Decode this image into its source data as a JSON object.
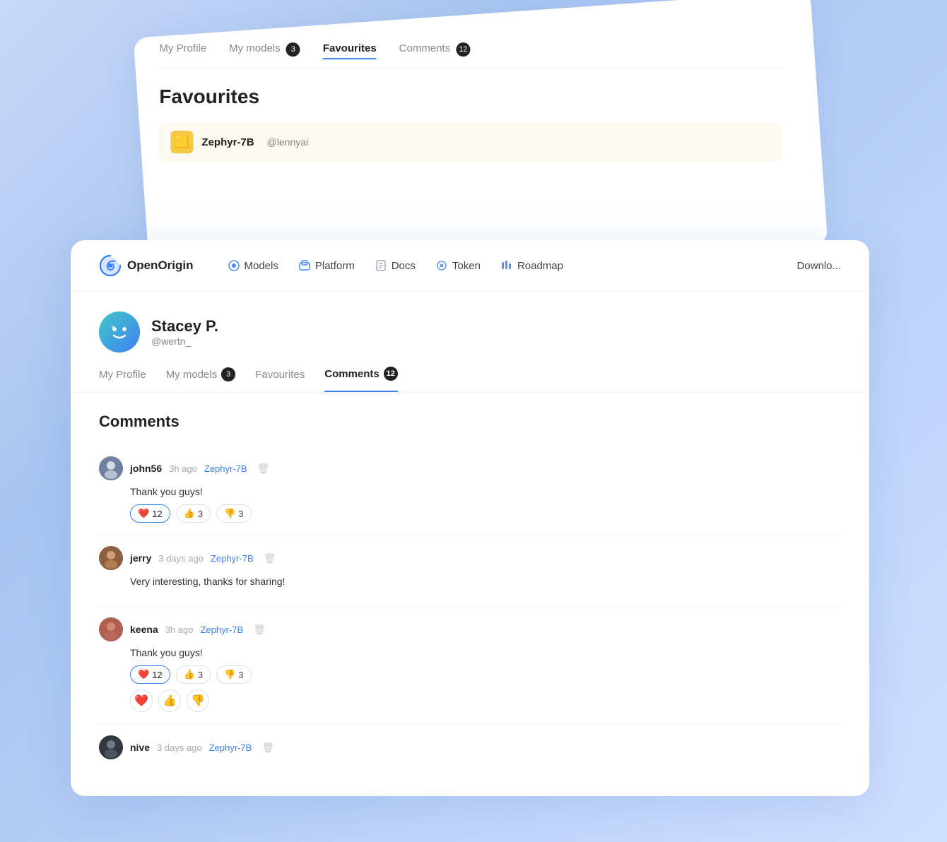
{
  "background_card": {
    "tabs": [
      {
        "label": "My Profile",
        "active": false
      },
      {
        "label": "My models",
        "badge": "3",
        "active": false
      },
      {
        "label": "Favourites",
        "active": true
      },
      {
        "label": "Comments",
        "badge": "12",
        "active": false
      }
    ],
    "title": "Favourites",
    "model": {
      "name": "Zephyr-7B",
      "user": "@lennyai",
      "icon": "🟨"
    }
  },
  "navbar": {
    "logo": "OpenOrigin",
    "links": [
      {
        "label": "Models",
        "icon": "🔵"
      },
      {
        "label": "Platform",
        "icon": "🟦"
      },
      {
        "label": "Docs",
        "icon": "📄"
      },
      {
        "label": "Token",
        "icon": "🔵"
      },
      {
        "label": "Roadmap",
        "icon": "📊"
      }
    ],
    "right": "Downlo..."
  },
  "profile": {
    "name": "Stacey P.",
    "handle": "@wertn_",
    "tabs": [
      {
        "label": "My Profile",
        "active": false
      },
      {
        "label": "My models",
        "badge": "3",
        "active": false
      },
      {
        "label": "Favourites",
        "active": false
      },
      {
        "label": "Comments",
        "badge": "12",
        "active": true
      }
    ]
  },
  "comments": {
    "title": "Comments",
    "items": [
      {
        "username": "john56",
        "time": "3h ago",
        "model": "Zephyr-7B",
        "body": "Thank you guys!",
        "reactions": [
          {
            "icon": "❤️",
            "count": "12",
            "highlight": true
          },
          {
            "icon": "👍",
            "count": "3"
          },
          {
            "icon": "👎",
            "count": "3"
          }
        ]
      },
      {
        "username": "jerry",
        "time": "3 days ago",
        "model": "Zephyr-7B",
        "body": "Very interesting, thanks for sharing!",
        "reactions": []
      },
      {
        "username": "keena",
        "time": "3h ago",
        "model": "Zephyr-7B",
        "body": "Thank you guys!",
        "reactions": [
          {
            "icon": "❤️",
            "count": "12",
            "highlight": true
          },
          {
            "icon": "👍",
            "count": "3"
          },
          {
            "icon": "👎",
            "count": "3"
          }
        ],
        "extra_reactions": [
          "❤️",
          "👍",
          "👎"
        ]
      },
      {
        "username": "nive",
        "time": "3 days ago",
        "model": "Zephyr-7B",
        "body": "",
        "reactions": []
      }
    ]
  }
}
